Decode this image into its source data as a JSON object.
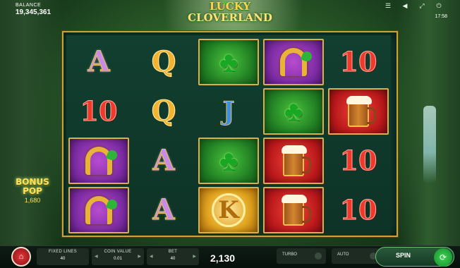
{
  "header": {
    "balance_label": "BALANCE",
    "balance_value": "19,345,361",
    "clock": "17:58",
    "icons": [
      "menu-icon",
      "sound-icon",
      "fullscreen-icon",
      "power-icon"
    ]
  },
  "logo": {
    "top": "LUCKY",
    "bottom": "CLOVERLAND"
  },
  "reels": [
    [
      {
        "type": "A"
      },
      {
        "type": "10"
      },
      {
        "type": "shoe"
      },
      {
        "type": "shoe"
      }
    ],
    [
      {
        "type": "Q"
      },
      {
        "type": "Q"
      },
      {
        "type": "A"
      },
      {
        "type": "A"
      }
    ],
    [
      {
        "type": "clover"
      },
      {
        "type": "J"
      },
      {
        "type": "clover"
      },
      {
        "type": "K"
      }
    ],
    [
      {
        "type": "shoe"
      },
      {
        "type": "clover"
      },
      {
        "type": "beer"
      },
      {
        "type": "beer"
      }
    ],
    [
      {
        "type": "10"
      },
      {
        "type": "beer"
      },
      {
        "type": "10"
      },
      {
        "type": "10"
      }
    ]
  ],
  "symbols": {
    "A": "A",
    "Q": "Q",
    "J": "J",
    "K": "K",
    "10": "10"
  },
  "bonus": {
    "title_line1": "BONUS",
    "title_line2": "POP",
    "value": "1,680"
  },
  "bottom_bar": {
    "fixed_lines_label": "FIXED LINES",
    "fixed_lines_value": "40",
    "coin_value_label": "COIN VALUE",
    "coin_value_value": "0.01",
    "bet_label": "BET",
    "bet_value": "40",
    "win_value": "2,130",
    "turbo_label": "TURBO",
    "auto_label": "AUTO",
    "spin_label": "SPIN"
  },
  "colors": {
    "frame_gold": "#c9a43a",
    "clover_bg": "#1f7a22",
    "shoe_bg": "#7a2aa0",
    "beer_bg": "#b8171a",
    "spin_green": "#3ed454"
  }
}
